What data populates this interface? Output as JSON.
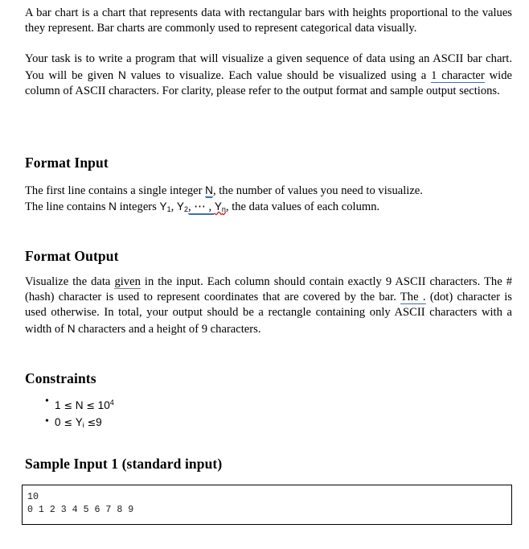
{
  "document": {
    "paragraphs": {
      "intro": {
        "part1": "A bar chart is a chart that represents data with rectangular bars with heights proportional to the values they represent. Bar charts are commonly used to represent categorical data visually.",
        "task_a": "Your task is to write a program that will visualize a given sequence of data using an ASCII bar chart. You will be given ",
        "task_var_n": "N",
        "task_b": " values to visualize. Each value should be visualized using a ",
        "task_underlined": "1 character",
        "task_c": " wide column of ASCII characters. For clarity, please refer to the output format and sample output sections."
      }
    },
    "sections": {
      "format_input": {
        "heading": "Format Input",
        "line1_a": "The first line contains a single integer ",
        "line1_var": "N",
        "line1_b": ", the number of values you need to visualize.",
        "line2_a": "The line contains ",
        "line2_var_n": "N",
        "line2_b": " integers ",
        "line2_y1": "Y",
        "line2_y1_sub": "1",
        "line2_sep1": ", ",
        "line2_y2": "Y",
        "line2_y2_sub": "2",
        "line2_dots": ", ⋯ , ",
        "line2_yn": "Y",
        "line2_yn_sub": "n",
        "line2_c": ", the data values of each column."
      },
      "format_output": {
        "heading": "Format Output",
        "text_a": "Visualize the data ",
        "text_underline_given": "given",
        "text_b": " in the input. Each column should contain exactly 9 ASCII characters. The # (hash) character is used to represent coordinates that are covered by the bar. ",
        "text_underline_the": "The .",
        "text_c": " (dot) character is used otherwise. In total, your output should be a rectangle containing only ASCII characters with a width of ",
        "text_var_n": "N",
        "text_d": " characters and a height of 9 characters."
      },
      "constraints": {
        "heading": "Constraints",
        "items": [
          {
            "lower": "1",
            "op1": "≤",
            "variable": "N",
            "op2": "≤",
            "upper_base": "10",
            "upper_exp": "4"
          },
          {
            "lower": "0",
            "op1": "≤",
            "variable": "Y",
            "variable_sub": "i",
            "op2": "≤",
            "upper_base": "9",
            "upper_exp": ""
          }
        ]
      },
      "sample_input": {
        "heading": "Sample Input 1 (standard input)",
        "lines": [
          "10",
          "0 1 2 3 4 5 6 7 8 9"
        ],
        "content": "10\n0 1 2 3 4 5 6 7 8 9"
      }
    },
    "colors": {
      "text": "#000000",
      "grammar_underline": "#3f6fa8",
      "spelling_underline": "#cc2222",
      "code_border": "#000000",
      "background": "#ffffff"
    }
  }
}
